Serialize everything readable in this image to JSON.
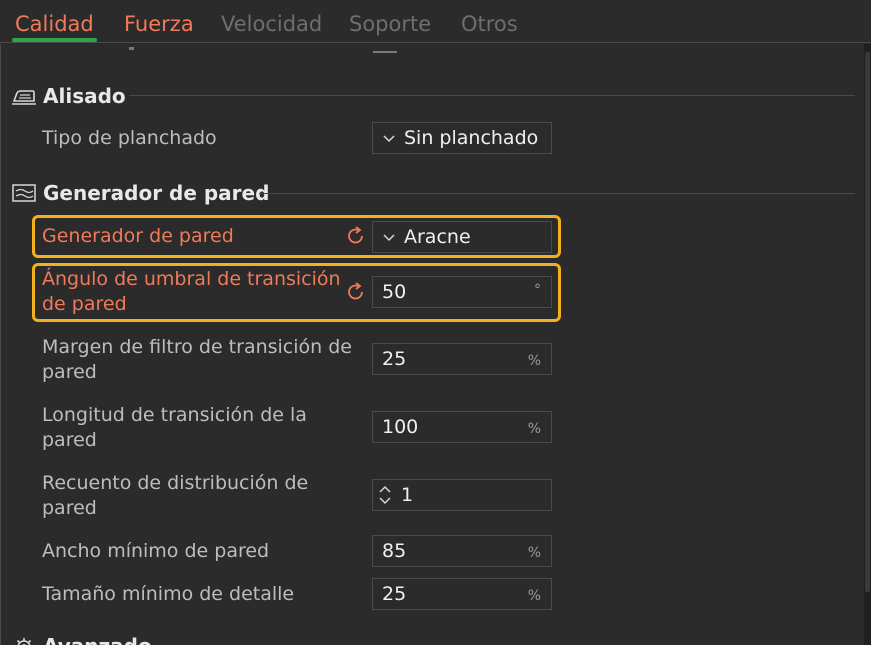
{
  "tabs": [
    {
      "label": "Calidad",
      "active": true
    },
    {
      "label": "Fuerza",
      "active": false
    },
    {
      "label": "Velocidad",
      "active": false
    },
    {
      "label": "Soporte",
      "active": false
    },
    {
      "label": "Otros",
      "active": false
    }
  ],
  "sections": {
    "alisado": {
      "title": "Alisado",
      "icon": "iron-icon",
      "rows": {
        "ironing_type": {
          "label": "Tipo de planchado",
          "value": "Sin planchado"
        }
      }
    },
    "wall_generator": {
      "title": "Generador de pared",
      "icon": "wall-icon",
      "rows": {
        "generator": {
          "label": "Generador de pared",
          "value": "Aracne"
        },
        "threshold_angle": {
          "label": "Ángulo de umbral de transición de pared",
          "value": "50",
          "unit": "°"
        },
        "filter_margin": {
          "label": "Margen de filtro de transición de pared",
          "value": "25",
          "unit": "%"
        },
        "transition_length": {
          "label": "Longitud de transición de la pared",
          "value": "100",
          "unit": "%"
        },
        "distribution_count": {
          "label": "Recuento de distribución de pared",
          "value": "1"
        },
        "min_wall_width": {
          "label": "Ancho mínimo de pared",
          "value": "85",
          "unit": "%"
        },
        "min_detail_size": {
          "label": "Tamaño mínimo de detalle",
          "value": "25",
          "unit": "%"
        }
      }
    },
    "next": {
      "title": "Avanzado",
      "icon": "gear-icon"
    }
  },
  "colors": {
    "accent": "#f07a5a",
    "active_tab_underline": "#2ea44f",
    "highlight": "#f2b01e",
    "background": "#2b2b2b"
  }
}
